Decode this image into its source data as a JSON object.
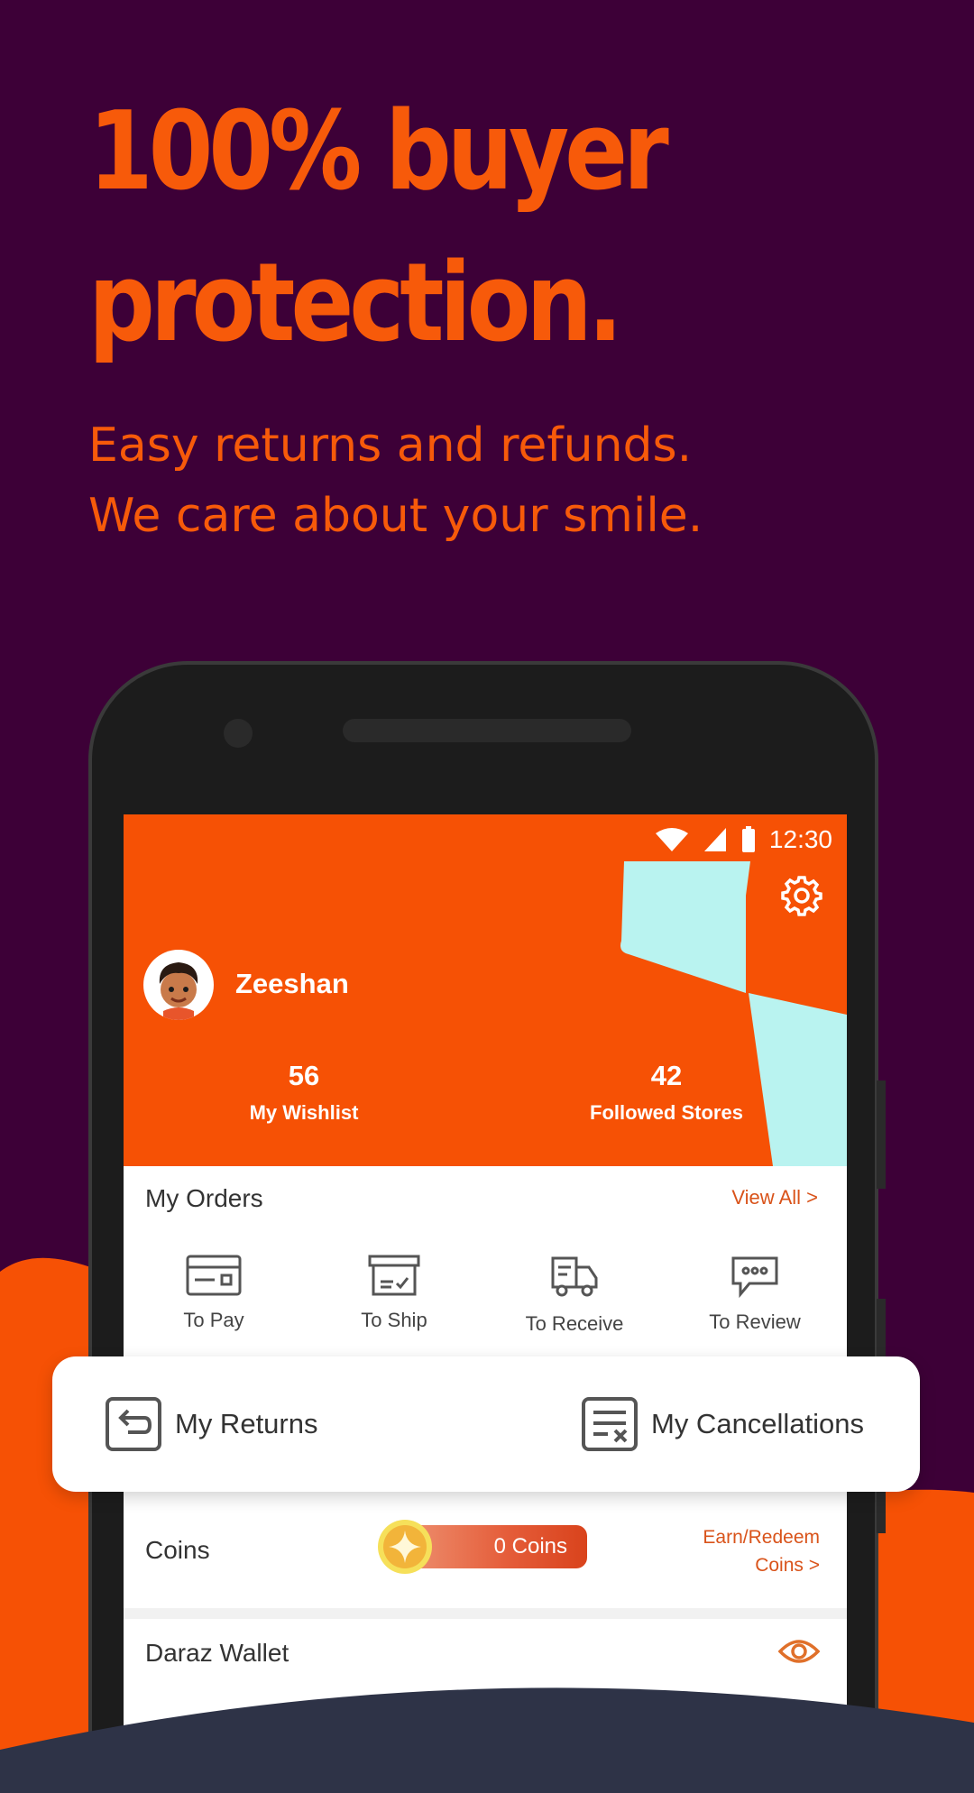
{
  "promo": {
    "headline_line1": "100% buyer",
    "headline_line2": "protection.",
    "sub_line1": "Easy returns and refunds.",
    "sub_line2": "We care about your smile."
  },
  "status_bar": {
    "time": "12:30"
  },
  "profile": {
    "name": "Zeeshan",
    "wishlist_count": "56",
    "wishlist_label": "My Wishlist",
    "followed_count": "42",
    "followed_label": "Followed Stores"
  },
  "orders": {
    "title": "My Orders",
    "view_all": "View All >",
    "items": [
      {
        "label": "To Pay",
        "icon": "card-icon"
      },
      {
        "label": "To Ship",
        "icon": "box-icon"
      },
      {
        "label": "To Receive",
        "icon": "truck-icon"
      },
      {
        "label": "To Review",
        "icon": "chat-bubble-icon"
      }
    ]
  },
  "card": {
    "returns_label": "My Returns",
    "cancellations_label": "My Cancellations"
  },
  "coins": {
    "label": "Coins",
    "amount": "0 Coins",
    "earn_line1": "Earn/Redeem",
    "earn_line2": "Coins",
    "earn_arrow": ">"
  },
  "wallet": {
    "label": "Daraz Wallet"
  },
  "colors": {
    "brand_orange": "#f65105",
    "background_purple": "#3d0037",
    "accent_cyan": "#b9f3f0",
    "dark_navy": "#2e3347"
  }
}
